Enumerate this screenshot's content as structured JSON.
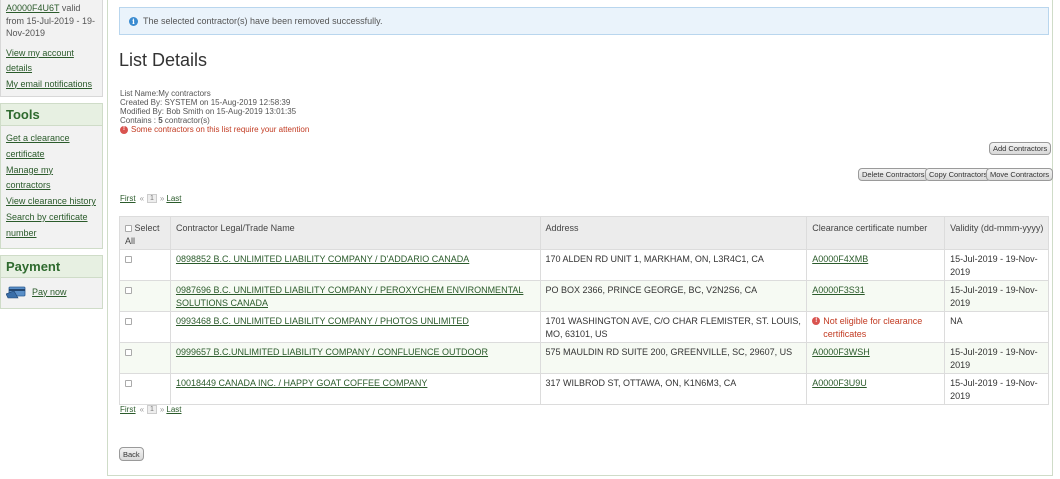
{
  "sidebar": {
    "cert_link": "A0000F4U6T",
    "cert_text": " valid from 15-Jul-2019 - 19-Nov-2019",
    "account_links": [
      "View my account details",
      "My email notifications"
    ],
    "tools": {
      "title": "Tools",
      "links": [
        "Get a clearance certificate",
        "Manage my contractors",
        "View clearance history",
        "Search by certificate number"
      ]
    },
    "payment": {
      "title": "Payment",
      "pay_label": "Pay now"
    }
  },
  "alert": {
    "message": "The selected contractor(s) have been removed successfully."
  },
  "page_title": "List Details",
  "meta": {
    "list_name": "List Name:My contractors",
    "created": "Created By: SYSTEM on 15-Aug-2019 12:58:39",
    "modified": "Modified By: Bob Smith on 15-Aug-2019 13:01:35",
    "contains_prefix": "Contains : ",
    "contains_count": "5",
    "contains_suffix": " contractor(s)",
    "attention": "Some contractors on this list require your attention"
  },
  "buttons": {
    "add": "Add Contractors",
    "delete": "Delete Contractors",
    "copy": "Copy Contractors",
    "move": "Move Contractors",
    "back": "Back"
  },
  "pager": {
    "first": "First",
    "sep1": "«",
    "page": "1",
    "sep2": "»",
    "last": "Last"
  },
  "table": {
    "headers": [
      "Select All",
      "Contractor Legal/Trade Name",
      "Address",
      "Clearance certificate number",
      "Validity (dd-mmm-yyyy)"
    ],
    "rows": [
      {
        "name": "0898852 B.C. UNLIMITED LIABILITY COMPANY / D'ADDARIO CANADA",
        "address": "170 ALDEN RD UNIT 1, MARKHAM, ON, L3R4C1, CA",
        "cert": "A0000F4XMB",
        "validity": "15-Jul-2019 - 19-Nov-2019"
      },
      {
        "name": "0987696 B.C. UNLIMITED LIABILITY COMPANY / PEROXYCHEM ENVIRONMENTAL SOLUTIONS CANADA",
        "address": "PO BOX 2366, PRINCE GEORGE, BC, V2N2S6, CA",
        "cert": "A0000F3S31",
        "validity": "15-Jul-2019 - 19-Nov-2019"
      },
      {
        "name": "0993468 B.C. UNLIMITED LIABILITY COMPANY / PHOTOS UNLIMITED",
        "address": "1701 WASHINGTON AVE, C/O CHAR FLEMISTER, ST. LOUIS, MO, 63101, US",
        "cert": "Not eligible for clearance certificates",
        "validity": "NA"
      },
      {
        "name": "0999657 B.C.UNLIMITED LIABILITY COMPANY / CONFLUENCE OUTDOOR",
        "address": "575 MAULDIN RD SUITE 200, GREENVILLE, SC, 29607, US",
        "cert": "A0000F3WSH",
        "validity": "15-Jul-2019 - 19-Nov-2019"
      },
      {
        "name": "10018449 CANADA INC. / HAPPY GOAT COFFEE COMPANY",
        "address": "317 WILBROD ST, OTTAWA, ON, K1N6M3, CA",
        "cert": "A0000F3U9U",
        "validity": "15-Jul-2019 - 19-Nov-2019"
      }
    ]
  },
  "colors": {
    "link": "#2b5b2b",
    "panel_header": "#e7f0e2",
    "alert_bg": "#eaf3fb",
    "error": "#c23b22"
  }
}
